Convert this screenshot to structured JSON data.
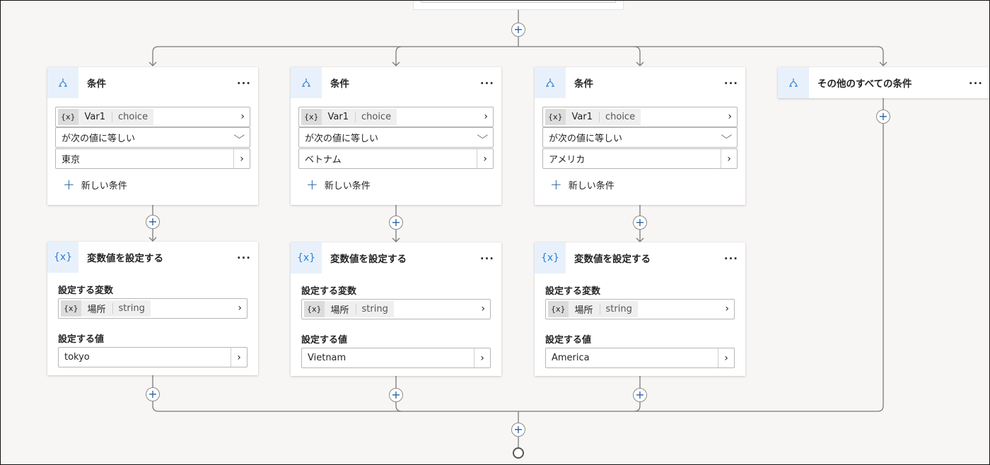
{
  "colors": {
    "accent": "#2a5fa0",
    "icon_bg": "#e8f1fb",
    "line": "#7a7a7a"
  },
  "icons": {
    "condition": "branch-icon",
    "set_variable": "variable-icon",
    "add": "plus-icon",
    "end": "end-circle-icon"
  },
  "branches": [
    {
      "condition": {
        "title": "条件",
        "more": "...",
        "var_icon": "{x}",
        "var_name": "Var1",
        "var_type": "choice",
        "operator": "が次の値に等しい",
        "value": "東京",
        "new_condition": "新しい条件"
      },
      "set_variable": {
        "title": "変数値を設定する",
        "more": "...",
        "icon": "{x}",
        "variable_label": "設定する変数",
        "var_icon": "{x}",
        "var_name": "場所",
        "var_type": "string",
        "value_label": "設定する値",
        "value": "tokyo"
      }
    },
    {
      "condition": {
        "title": "条件",
        "more": "...",
        "var_icon": "{x}",
        "var_name": "Var1",
        "var_type": "choice",
        "operator": "が次の値に等しい",
        "value": "ベトナム",
        "new_condition": "新しい条件"
      },
      "set_variable": {
        "title": "変数値を設定する",
        "more": "...",
        "icon": "{x}",
        "variable_label": "設定する変数",
        "var_icon": "{x}",
        "var_name": "場所",
        "var_type": "string",
        "value_label": "設定する値",
        "value": "Vietnam"
      }
    },
    {
      "condition": {
        "title": "条件",
        "more": "...",
        "var_icon": "{x}",
        "var_name": "Var1",
        "var_type": "choice",
        "operator": "が次の値に等しい",
        "value": "アメリカ",
        "new_condition": "新しい条件"
      },
      "set_variable": {
        "title": "変数値を設定する",
        "more": "...",
        "icon": "{x}",
        "variable_label": "設定する変数",
        "var_icon": "{x}",
        "var_name": "場所",
        "var_type": "string",
        "value_label": "設定する値",
        "value": "America"
      }
    }
  ],
  "else_branch": {
    "title": "その他のすべての条件",
    "more": "..."
  },
  "glyphs": {
    "plus": "+",
    "chevron": "›",
    "caret": "⌵"
  }
}
